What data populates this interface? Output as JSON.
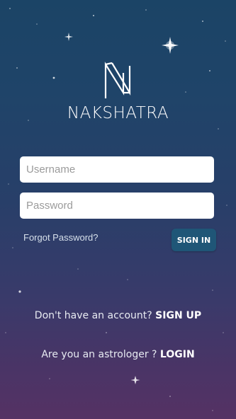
{
  "brand": {
    "name": "NAKSHATRA"
  },
  "login_form": {
    "username_placeholder": "Username",
    "username_value": "",
    "password_placeholder": "Password",
    "password_value": "",
    "forgot_password_label": "Forgot Password?",
    "sign_in_label": "SIGN IN"
  },
  "footer": {
    "signup_prompt": "Don't have an account?",
    "signup_link": "SIGN UP",
    "astrologer_prompt": "Are you an astrologer ?",
    "astrologer_link": "LOGIN"
  },
  "colors": {
    "background_top": "#1b4466",
    "background_bottom": "#553264",
    "sign_in_button": "#1f5677",
    "text": "#ffffff"
  },
  "icons": {
    "logo": "nakshatra-logo-mark",
    "stars": "star-icon"
  }
}
